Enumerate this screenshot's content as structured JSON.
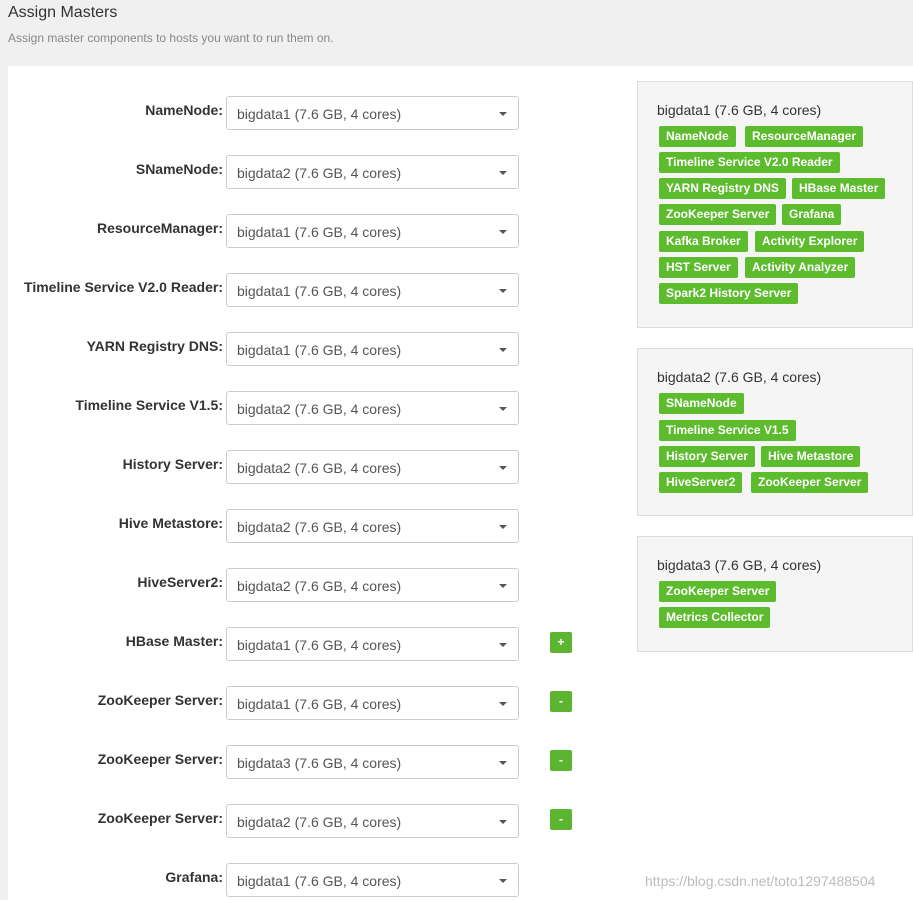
{
  "header": {
    "title": "Assign Masters",
    "subtitle": "Assign master components to hosts you want to run them on."
  },
  "assignments": [
    {
      "label": "NameNode:",
      "value": "bigdata1 (7.6 GB, 4 cores)"
    },
    {
      "label": "SNameNode:",
      "value": "bigdata2 (7.6 GB, 4 cores)"
    },
    {
      "label": "ResourceManager:",
      "value": "bigdata1 (7.6 GB, 4 cores)"
    },
    {
      "label": "Timeline Service V2.0 Reader:",
      "value": "bigdata1 (7.6 GB, 4 cores)"
    },
    {
      "label": "YARN Registry DNS:",
      "value": "bigdata1 (7.6 GB, 4 cores)"
    },
    {
      "label": "Timeline Service V1.5:",
      "value": "bigdata2 (7.6 GB, 4 cores)"
    },
    {
      "label": "History Server:",
      "value": "bigdata2 (7.6 GB, 4 cores)"
    },
    {
      "label": "Hive Metastore:",
      "value": "bigdata2 (7.6 GB, 4 cores)"
    },
    {
      "label": "HiveServer2:",
      "value": "bigdata2 (7.6 GB, 4 cores)"
    },
    {
      "label": "HBase Master:",
      "value": "bigdata1 (7.6 GB, 4 cores)",
      "control": "+"
    },
    {
      "label": "ZooKeeper Server:",
      "value": "bigdata1 (7.6 GB, 4 cores)",
      "control": "-"
    },
    {
      "label": "ZooKeeper Server:",
      "value": "bigdata3 (7.6 GB, 4 cores)",
      "control": "-"
    },
    {
      "label": "ZooKeeper Server:",
      "value": "bigdata2 (7.6 GB, 4 cores)",
      "control": "-"
    },
    {
      "label": "Grafana:",
      "value": "bigdata1 (7.6 GB, 4 cores)"
    }
  ],
  "hosts": [
    {
      "title": "bigdata1 (7.6 GB, 4 cores)",
      "components": [
        "NameNode",
        "ResourceManager",
        "Timeline Service V2.0 Reader",
        "YARN Registry DNS",
        "HBase Master",
        "ZooKeeper Server",
        "Grafana",
        "Kafka Broker",
        "Activity Explorer",
        "HST Server",
        "Activity Analyzer",
        "Spark2 History Server"
      ]
    },
    {
      "title": "bigdata2 (7.6 GB, 4 cores)",
      "components": [
        "SNameNode",
        "Timeline Service V1.5",
        "History Server",
        "Hive Metastore",
        "HiveServer2",
        "ZooKeeper Server"
      ]
    },
    {
      "title": "bigdata3 (7.6 GB, 4 cores)",
      "components": [
        "ZooKeeper Server",
        "Metrics Collector"
      ]
    }
  ],
  "watermark": "https://blog.csdn.net/toto1297488504",
  "colors": {
    "accent": "#5cb531"
  }
}
